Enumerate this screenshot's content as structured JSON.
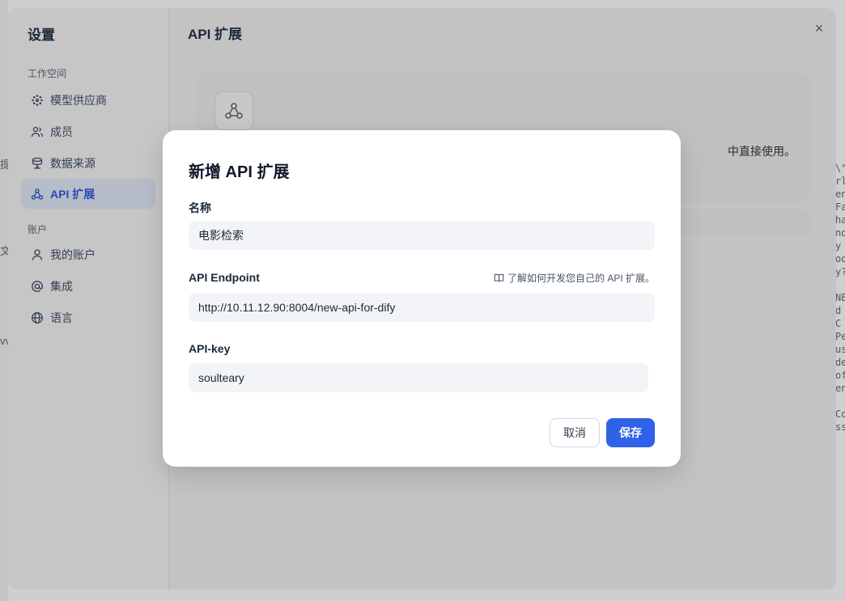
{
  "background": {
    "right_text": "\\\"\nrl\nen\nFa\nha\nnd\ny\nod\ny?\n\nNE\nd\nC\nPe\nus\ndec\nof,\nen\n\nCo\nssi",
    "left_glyphs": [
      "提",
      "文",
      "vv"
    ]
  },
  "settings": {
    "title": "设置",
    "sections": [
      {
        "label": "工作空间",
        "items": [
          {
            "label": "模型供应商",
            "icon": "model-provider-icon"
          },
          {
            "label": "成员",
            "icon": "members-icon"
          },
          {
            "label": "数据来源",
            "icon": "data-source-icon"
          },
          {
            "label": "API 扩展",
            "icon": "webhook-icon",
            "active": true
          }
        ]
      },
      {
        "label": "账户",
        "items": [
          {
            "label": "我的账户",
            "icon": "user-icon"
          },
          {
            "label": "集成",
            "icon": "at-icon"
          },
          {
            "label": "语言",
            "icon": "globe-icon"
          }
        ]
      }
    ],
    "content_title": "API 扩展",
    "card_desc": "中直接使用。"
  },
  "modal": {
    "title": "新增 API 扩展",
    "name_label": "名称",
    "name_value": "电影检索",
    "endpoint_label": "API Endpoint",
    "endpoint_value": "http://10.11.12.90:8004/new-api-for-dify",
    "doc_link": "了解如何开发您自己的 API 扩展。",
    "apikey_label": "API-key",
    "apikey_value": "soulteary",
    "cancel_label": "取消",
    "save_label": "保存"
  },
  "colors": {
    "primary": "#2f62e9",
    "active_nav_text": "#2a4bb0",
    "input_bg": "#f2f4f7"
  }
}
